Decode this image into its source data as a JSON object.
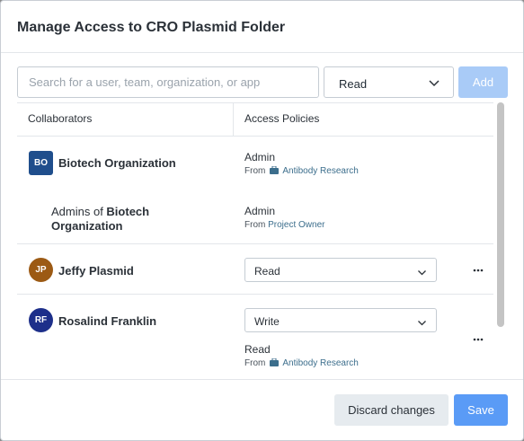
{
  "dialog": {
    "title": "Manage Access to CRO Plasmid Folder"
  },
  "toolbar": {
    "search_placeholder": "Search for a user, team, organization, or app",
    "search_value": "",
    "permission_value": "Read",
    "add_label": "Add"
  },
  "table": {
    "headers": {
      "collaborators": "Collaborators",
      "policies": "Access Policies"
    },
    "rows": [
      {
        "avatar_initials": "BO",
        "avatar_color": "#1f4e8c",
        "name": "Biotech Organization",
        "policy": "Admin",
        "from_prefix": "From",
        "from_source": "Antibody Research",
        "from_icon": "briefcase-icon"
      },
      {
        "name_prefix": "Admins of ",
        "name_bold_1": "Biotech",
        "name_bold_2": "Organization",
        "policy": "Admin",
        "from_prefix": "From",
        "from_source": "Project Owner"
      },
      {
        "avatar_initials": "JP",
        "avatar_color": "#9c5a14",
        "name": "Jeffy Plasmid",
        "select_value": "Read",
        "more_icon": "more-options-icon"
      },
      {
        "avatar_initials": "RF",
        "avatar_color": "#1d2f8a",
        "name": "Rosalind Franklin",
        "select_value": "Write",
        "policy": "Read",
        "from_prefix": "From",
        "from_source": "Antibody Research",
        "from_icon": "briefcase-icon",
        "more_icon": "more-options-icon"
      }
    ]
  },
  "footer": {
    "discard_label": "Discard changes",
    "save_label": "Save"
  },
  "colors": {
    "primary": "#5a9bf6",
    "primary_disabled": "#a9cbf7",
    "link": "#3c6e8c"
  }
}
